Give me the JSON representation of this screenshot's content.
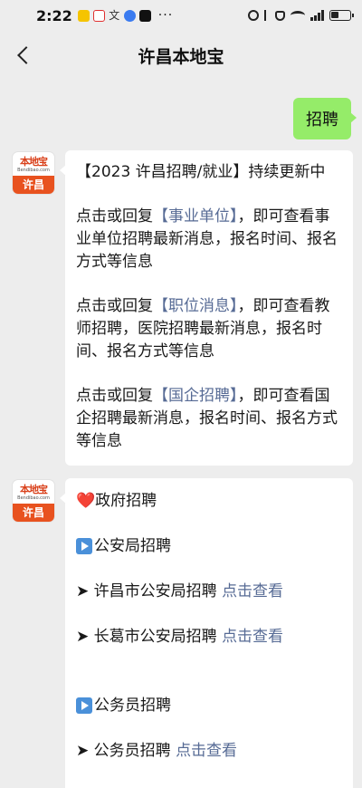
{
  "status": {
    "time": "2:22",
    "more": "···",
    "network": "4G"
  },
  "nav": {
    "title": "许昌本地宝"
  },
  "sent": {
    "text": "招聘"
  },
  "avatar": {
    "top": "本地宝",
    "url": "Bendibao.com",
    "bottom": "许昌"
  },
  "msg1": {
    "title": "【2023 许昌招聘/就业】持续更新中",
    "p1_a": "点击或回复",
    "p1_link": "【事业单位】",
    "p1_b": "，即可查看事业单位招聘最新消息，报名时间、报名方式等信息",
    "p2_a": "点击或回复",
    "p2_link": "【职位消息】",
    "p2_b": "，即可查看教师招聘，医院招聘最新消息，报名时间、报名方式等信息",
    "p3_a": "点击或回复",
    "p3_link": "【国企招聘】",
    "p3_b": "，即可查看国企招聘最新消息，报名时间、报名方式等信息"
  },
  "msg2": {
    "heart": "❤️",
    "section1": "政府招聘",
    "sub1": "公安局招聘",
    "item1_prefix": "➤ 许昌市公安局招聘",
    "item1_link": "点击查看",
    "item2_prefix": "➤ 长葛市公安局招聘",
    "item2_link": "点击查看",
    "sub2": "公务员招聘",
    "item3_prefix": "➤ 公务员招聘",
    "item3_link": "点击查看"
  }
}
